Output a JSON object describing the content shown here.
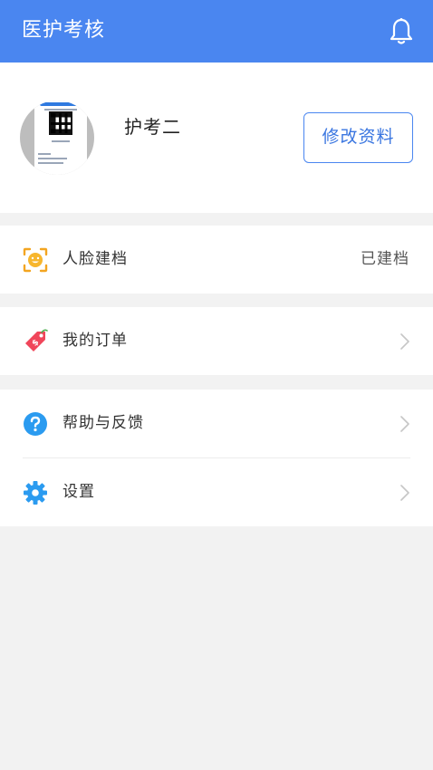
{
  "app_bar": {
    "title": "医护考核",
    "notification_icon": "bell-icon",
    "color": "#4a86f0"
  },
  "profile": {
    "username": "护考二",
    "edit_button_label": "修改资料"
  },
  "menu": {
    "face": {
      "label": "人脸建档",
      "status": "已建档",
      "icon": "face-scan-icon"
    },
    "orders": {
      "label": "我的订单",
      "icon": "price-tag-icon"
    },
    "help": {
      "label": "帮助与反馈",
      "icon": "help-circle-icon"
    },
    "settings": {
      "label": "设置",
      "icon": "gear-icon"
    }
  }
}
